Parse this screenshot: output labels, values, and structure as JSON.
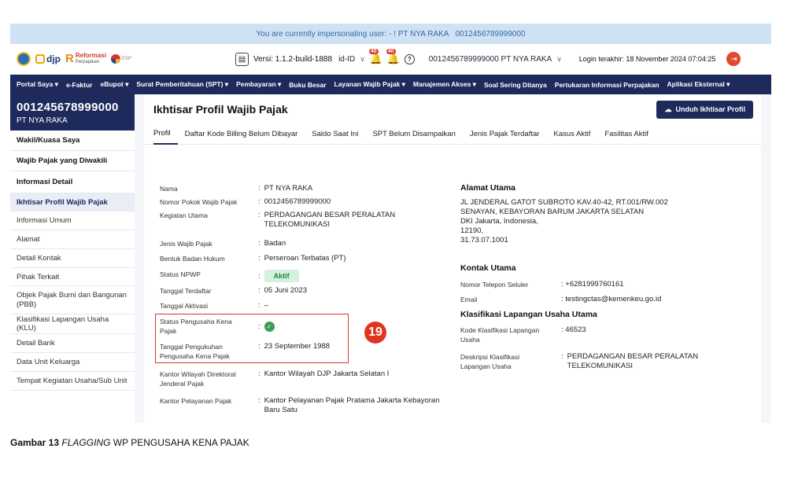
{
  "impersonation": {
    "text": "You are currently impersonating user: - ! PT NYA RAKA",
    "npwp": "0012456789999000"
  },
  "topbar": {
    "logo_djp": "djp",
    "logo_reformasi": "Reformasi",
    "logo_reformasi_sub": "Perpajakan",
    "logo_esp": "ESP",
    "versi": "Versi: 1.1.2-build-1888",
    "language": "id-ID",
    "notif_count_1": "40",
    "notif_count_2": "40",
    "taxpayer": "0012456789999000 PT NYA RAKA",
    "last_login": "Login terakhir: 18 November 2024 07:04:25"
  },
  "nav": [
    "Portal Saya ▾",
    "e-Faktur",
    "eBupot ▾",
    "Surat Pemberitahuan (SPT) ▾",
    "Pembayaran ▾",
    "Buku Besar",
    "Layanan Wajib Pajak ▾",
    "Manajemen Akses ▾",
    "Soal Sering Ditanya",
    "Pertukaran Informasi Perpajakan",
    "Aplikasi Eksternal ▾"
  ],
  "sidebar": {
    "npwp": "001245678999000",
    "name": "PT NYA RAKA",
    "items": [
      "Wakil/Kuasa Saya",
      "Wajib Pajak yang Diwakili",
      "Informasi Detail",
      "Ikhtisar Profil Wajib Pajak",
      "Informasi Umum",
      "Alamat",
      "Detail Kontak",
      "Pihak Terkait",
      "Objek Pajak Bumi dan Bangunan (PBB)",
      "Klasifikasi Lapangan Usaha (KLU)",
      "Detail Bank",
      "Data Unit Keluarga",
      "Tempat Kegiatan Usaha/Sub Unit"
    ]
  },
  "main": {
    "title": "Ikhtisar Profil Wajib Pajak",
    "download_label": "Unduh Ikhtisar Profil",
    "tabs": [
      "Profil",
      "Daftar Kode Billing Belum Dibayar",
      "Saldo Saat Ini",
      "SPT Belum Disampaikan",
      "Jenis Pajak Terdaftar",
      "Kasus Aktif",
      "Fasilitas Aktif"
    ]
  },
  "profile": {
    "nama_lbl": "Nama",
    "nama": "PT NYA RAKA",
    "npwp_lbl": "Nomor Pokok Wajib Pajak",
    "npwp": "0012456789999000",
    "kegiatan_lbl": "Kegiatan Utama",
    "kegiatan": "PERDAGANGAN BESAR PERALATAN TELEKOMUNIKASI",
    "jenis_lbl": "Jenis Wajib Pajak",
    "jenis": "Badan",
    "bentuk_lbl": "Bentuk Badan Hukum",
    "bentuk": "Perseroan Terbatas (PT)",
    "status_lbl": "Status NPWP",
    "status": "Aktif",
    "terdaftar_lbl": "Tanggal Terdaftar",
    "terdaftar": "05 Juni 2023",
    "aktivasi_lbl": "Tanggal Aktivasi",
    "aktivasi": "–",
    "pkp_lbl": "Status Pengusaha Kena Pajak",
    "pengukuhan_lbl": "Tanggal Pengukuhan Pengusaha Kena Pajak",
    "pengukuhan": "23 September 1988",
    "kanwil_lbl": "Kantor Wilayah Direktorat Jenderal Pajak",
    "kanwil": "Kantor Wilayah DJP Jakarta Selatan I",
    "kpp_lbl": "Kantor Pelayanan Pajak",
    "kpp": "Kantor Pelayanan Pajak Pratama Jakarta Kebayoran Baru Satu"
  },
  "address": {
    "title": "Alamat Utama",
    "line1": "JL JENDERAL GATOT SUBROTO KAV.40-42, RT.001/RW.002",
    "line2": "SENAYAN, KEBAYORAN BARUM JAKARTA SELATAN",
    "line3": "DKI Jakarta, Indonesia,",
    "line4": "12190,",
    "line5": "31.73.07.1001"
  },
  "contact": {
    "title": "Kontak Utama",
    "phone_lbl": "Nomor Telepon Seluler",
    "phone": "+6281999760161",
    "email_lbl": "Email",
    "email": "testingctas@kemenkeu.go.id"
  },
  "klu": {
    "title": "Klasifikasi Lapangan Usaha Utama",
    "kode_lbl": "Kode Klasifikasi Lapangan Usaha",
    "kode": "46523",
    "desk_lbl": "Deskripsi Klasifikasi Lapangan Usaha",
    "desk": "PERDAGANGAN BESAR PERALATAN TELEKOMUNIKASI"
  },
  "annotation_number": "19",
  "caption": {
    "bold": "Gambar 13",
    "italic": "FLAGGING",
    "rest": "WP PENGUSAHA KENA PAJAK"
  },
  "colors": {
    "navy": "#1e2a5c",
    "accent_red": "#e0341f",
    "active_green": "#1a8a3c"
  }
}
